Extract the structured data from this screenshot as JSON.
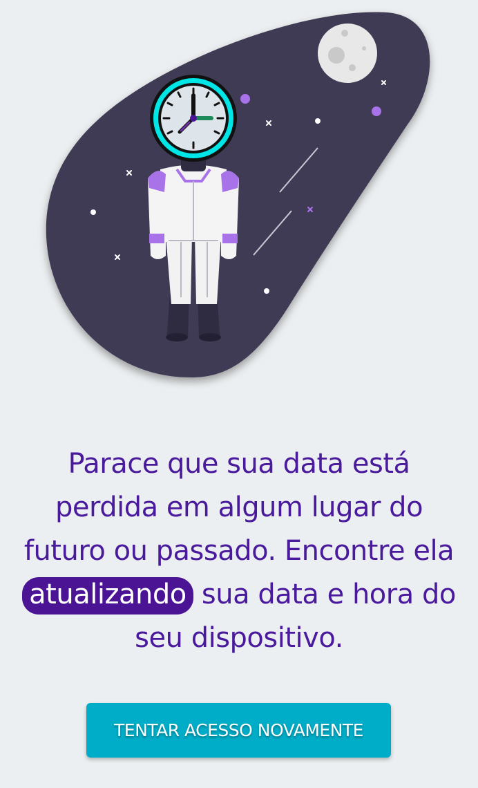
{
  "message": {
    "before": "Parace que sua data está perdida em algum lugar do futuro ou passado. Encontre ela ",
    "highlight": "atualizando",
    "after": " sua data e hora do seu dispositivo."
  },
  "button": {
    "label": "TENTAR ACESSO NOVAMENTE"
  },
  "colors": {
    "background": "#eceff1",
    "space_blob": "#3f3b55",
    "text": "#4a1a9c",
    "highlight": "#4a1494",
    "button": "#00adc8",
    "accent_purple": "#a873e8",
    "clock_ring": "#00e5e5"
  },
  "icons": {
    "illustration": "astronaut-clock-illustration",
    "moon": "moon-icon",
    "clock": "clock-icon"
  }
}
